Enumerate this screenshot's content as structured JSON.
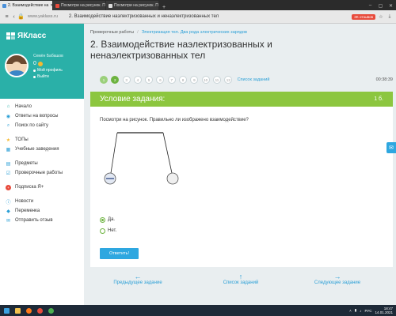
{
  "browser": {
    "tabs": [
      {
        "label": "2. Взаимодействие на",
        "active": true
      },
      {
        "label": "Посмотри на рисунок. П",
        "active": false
      },
      {
        "label": "Посмотри на рисунок. П",
        "active": false
      }
    ],
    "url": "www.yaklass.ru",
    "page_title": "2. Взаимодействие наэлектризованных и ненаэлектризованных тел",
    "reviews_badge": "3K отзывов"
  },
  "sidebar": {
    "logo": "ЯКласс",
    "user_name": "Семён Бабашов",
    "score": "0",
    "profile_link": "Мой профиль",
    "logout_link": "Выйти",
    "menu": [
      {
        "label": "Начало",
        "icon": "home-icon"
      },
      {
        "label": "Ответы на вопросы",
        "icon": "chat-icon"
      },
      {
        "label": "Поиск по сайту",
        "icon": "search-icon"
      },
      {
        "label": "ТОПы",
        "icon": "star-icon"
      },
      {
        "label": "Учебные заведения",
        "icon": "building-icon"
      },
      {
        "label": "Предметы",
        "icon": "grid-icon"
      },
      {
        "label": "Проверочные работы",
        "icon": "checklist-icon"
      },
      {
        "label": "Подписка Я+",
        "icon": "plus-badge-icon"
      },
      {
        "label": "Новости",
        "icon": "info-icon"
      },
      {
        "label": "Переменка",
        "icon": "gamepad-icon"
      },
      {
        "label": "Отправить отзыв",
        "icon": "feedback-icon"
      }
    ]
  },
  "breadcrumb": {
    "root": "Проверочные работы",
    "current": "Электризация тел. Два рода электрических зарядов"
  },
  "title": "2. Взаимодействие наэлектризованных и ненаэлектризованных тел",
  "pager": {
    "pages": [
      "1",
      "2",
      "3",
      "4",
      "5",
      "6",
      "7",
      "8",
      "9",
      "10",
      "11",
      "12"
    ],
    "done": [
      "1"
    ],
    "current": "2",
    "all_link": "Список заданий",
    "timer": "00:38:39"
  },
  "task": {
    "header": "Условие задания:",
    "points": "1 б.",
    "question": "Посмотри на рисунок. Правильно ли изображено взаимодействие?",
    "options": [
      {
        "label": "Да.",
        "selected": true
      },
      {
        "label": "Нет.",
        "selected": false
      }
    ],
    "submit": "Ответить!"
  },
  "bottom_nav": {
    "prev": "Предыдущее задание",
    "list": "Список заданий",
    "next": "Следующее задание"
  },
  "taskbar": {
    "time": "18:47",
    "date": "14.01.2021",
    "lang": "РУС"
  },
  "colors": {
    "brand_teal": "#2ab0a8",
    "header_green": "#8cc63f",
    "accent_blue": "#2ea7e0",
    "link_blue": "#2a9fd6"
  }
}
